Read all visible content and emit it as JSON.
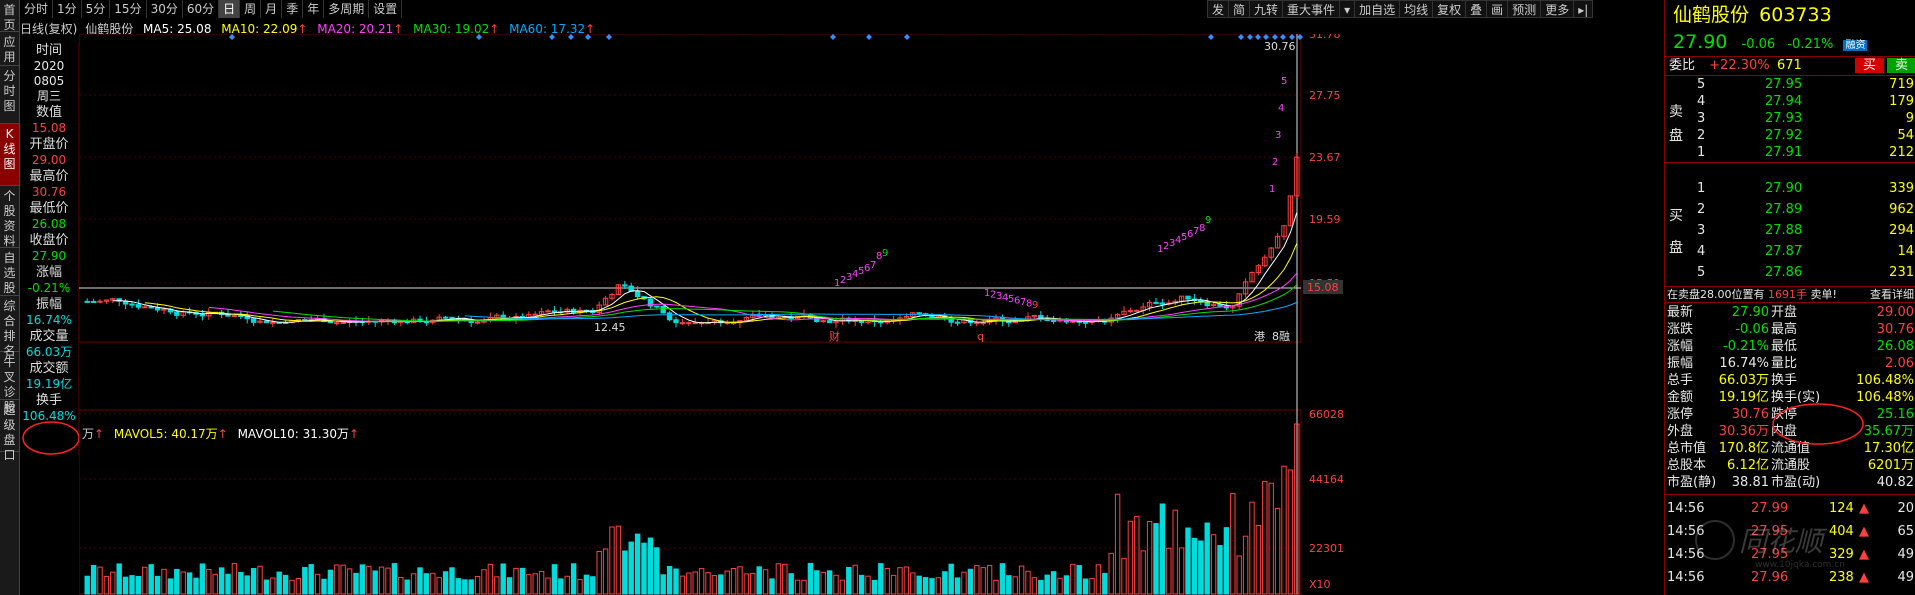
{
  "left_nav": [
    {
      "id": "home",
      "label": "首页"
    },
    {
      "id": "app",
      "label": "应用"
    },
    {
      "id": "intraday",
      "label": "分时图"
    },
    {
      "id": "kline",
      "label": "K线图",
      "active": true
    },
    {
      "id": "profile",
      "label": "个股资料"
    },
    {
      "id": "watchlist",
      "label": "自选股"
    },
    {
      "id": "rank",
      "label": "综合排名"
    },
    {
      "id": "niuwen",
      "label": "牛叉诊股"
    },
    {
      "id": "l2",
      "label": "超级盘口"
    }
  ],
  "period_tabs": [
    "分时",
    "1分",
    "5分",
    "15分",
    "30分",
    "60分",
    "日",
    "周",
    "月",
    "季",
    "年",
    "多周期",
    "设置"
  ],
  "period_active": "日",
  "toolbar_right": [
    "发",
    "简",
    "九转",
    "重大事件",
    "▾",
    "加自选",
    "均线",
    "复权",
    "叠",
    "画",
    "预测",
    "更多",
    "▸|"
  ],
  "chart_header": {
    "title": "日线(复权)",
    "stock": "仙鹤股份",
    "ma5": "MA5: 25.08",
    "ma10": "MA10: 22.09",
    "ma20": "MA20: 20.21",
    "ma30": "MA30: 19.02",
    "ma60": "MA60: 17.32",
    "arrow": "↑"
  },
  "info_column": [
    {
      "label": "时间",
      "value": null
    },
    {
      "label": null,
      "value": "2020",
      "color": "#e6e6e6"
    },
    {
      "label": null,
      "value": "0805",
      "color": "#e6e6e6"
    },
    {
      "label": null,
      "value": "周三",
      "color": "#e6e6e6"
    },
    {
      "label": "数值",
      "value": null
    },
    {
      "label": null,
      "value": "15.08",
      "color": "#ff4040"
    },
    {
      "label": "开盘价",
      "value": null
    },
    {
      "label": null,
      "value": "29.00",
      "color": "#ff4040"
    },
    {
      "label": "最高价",
      "value": null
    },
    {
      "label": null,
      "value": "30.76",
      "color": "#ff4040"
    },
    {
      "label": "最低价",
      "value": null
    },
    {
      "label": null,
      "value": "26.08",
      "color": "#00e000"
    },
    {
      "label": "收盘价",
      "value": null
    },
    {
      "label": null,
      "value": "27.90",
      "color": "#00e000"
    },
    {
      "label": "涨幅",
      "value": null
    },
    {
      "label": null,
      "value": "-0.21%",
      "color": "#00e000"
    },
    {
      "label": "振幅",
      "value": null
    },
    {
      "label": null,
      "value": "16.74%",
      "color": "#00dcdc"
    },
    {
      "label": "成交量",
      "value": null
    },
    {
      "label": null,
      "value": "66.03万",
      "color": "#00dcdc"
    },
    {
      "label": "成交额",
      "value": null
    },
    {
      "label": null,
      "value": "19.19亿",
      "color": "#00dcdc"
    },
    {
      "label": "换手",
      "value": null
    },
    {
      "label": null,
      "value": "106.48%",
      "color": "#00dcdc"
    }
  ],
  "price_axis": [
    "31.78",
    "27.75",
    "23.67",
    "19.59",
    "15.51"
  ],
  "price_axis_current": "15.08",
  "vol_axis": [
    "66028",
    "44164",
    "22301",
    "X10"
  ],
  "annotations": {
    "high_label": "30.76",
    "low_label": "12.45",
    "marker_cai": "财",
    "marker_q": "q",
    "marker_gang": "港",
    "marker_8": "8",
    "marker_ji": "融"
  },
  "td_seq_up_1": [
    "1",
    "2",
    "3",
    "4",
    "5",
    "6",
    "7",
    "8",
    "9"
  ],
  "td_seq_up_2": [
    "1",
    "2",
    "3",
    "4",
    "5",
    "6",
    "7",
    "8",
    "9"
  ],
  "td_seq_down": [
    "1",
    "2",
    "3",
    "4",
    "5",
    "6",
    "7",
    "8",
    "9"
  ],
  "td_seq_up_final": [
    "1",
    "2",
    "3",
    "4",
    "5"
  ],
  "vol_header": {
    "unit": "万",
    "arrow": "↑",
    "mavol5": "MAVOL5: 40.17万",
    "mavol10": "MAVOL10: 31.30万"
  },
  "quote": {
    "name": "仙鹤股份",
    "code": "603733",
    "price": "27.90",
    "change": "-0.06",
    "pct": "-0.21%",
    "tag": "融资",
    "webi_label": "委比",
    "webi_value": "+22.30%",
    "webi_diff": "671",
    "buy_btn": "买",
    "sell_btn": "卖"
  },
  "sell_levels": [
    {
      "n": "5",
      "price": "27.95",
      "vol": "719"
    },
    {
      "n": "4",
      "price": "27.94",
      "vol": "179"
    },
    {
      "n": "3",
      "price": "27.93",
      "vol": "9"
    },
    {
      "n": "2",
      "price": "27.92",
      "vol": "54"
    },
    {
      "n": "1",
      "price": "27.91",
      "vol": "212"
    }
  ],
  "buy_levels": [
    {
      "n": "1",
      "price": "27.90",
      "vol": "339"
    },
    {
      "n": "2",
      "price": "27.89",
      "vol": "962"
    },
    {
      "n": "3",
      "price": "27.88",
      "vol": "294"
    },
    {
      "n": "4",
      "price": "27.87",
      "vol": "14"
    },
    {
      "n": "5",
      "price": "27.86",
      "vol": "231"
    }
  ],
  "sell_side_label": [
    "卖",
    "盘"
  ],
  "buy_side_label": [
    "买",
    "盘"
  ],
  "order_notice": {
    "text": "在卖盘28.00位置有",
    "qty": "1691手",
    "tag": "卖单!",
    "link": "查看详细"
  },
  "stats": [
    {
      "l1": "最新",
      "v1": "27.90",
      "c1": "#00e000",
      "l2": "开盘",
      "v2": "29.00",
      "c2": "#ff4040"
    },
    {
      "l1": "涨跌",
      "v1": "-0.06",
      "c1": "#00e000",
      "l2": "最高",
      "v2": "30.76",
      "c2": "#ff4040"
    },
    {
      "l1": "涨幅",
      "v1": "-0.21%",
      "c1": "#00e000",
      "l2": "最低",
      "v2": "26.08",
      "c2": "#00e000"
    },
    {
      "l1": "振幅",
      "v1": "16.74%",
      "c1": "#e6e6e6",
      "l2": "量比",
      "v2": "2.06",
      "c2": "#ff4040"
    },
    {
      "l1": "总手",
      "v1": "66.03万",
      "c1": "#ffff00",
      "l2": "换手",
      "v2": "106.48%",
      "c2": "#ffff00"
    },
    {
      "l1": "金额",
      "v1": "19.19亿",
      "c1": "#ffff00",
      "l2": "换手(实)",
      "v2": "106.48%",
      "c2": "#ffff00"
    },
    {
      "l1": "涨停",
      "v1": "30.76",
      "c1": "#ff4040",
      "l2": "跌停",
      "v2": "25.16",
      "c2": "#00e000"
    },
    {
      "l1": "外盘",
      "v1": "30.36万",
      "c1": "#ff4040",
      "l2": "内盘",
      "v2": "35.67万",
      "c2": "#00e000"
    },
    {
      "l1": "总市值",
      "v1": "170.8亿",
      "c1": "#ffff00",
      "l2": "流通值",
      "v2": "17.30亿",
      "c2": "#ffff00"
    },
    {
      "l1": "总股本",
      "v1": "6.12亿",
      "c1": "#ffff00",
      "l2": "流通股",
      "v2": "6201万",
      "c2": "#ffff00"
    },
    {
      "l1": "市盈(静)",
      "v1": "38.81",
      "c1": "#e6e6e6",
      "l2": "市盈(动)",
      "v2": "40.82",
      "c2": "#e6e6e6"
    }
  ],
  "ticks": [
    {
      "time": "14:56",
      "price": "27.99",
      "pc": "#ff4040",
      "vol": "124",
      "dir": "up",
      "vol2": "20"
    },
    {
      "time": "14:56",
      "price": "27.95",
      "pc": "#ff4040",
      "vol": "404",
      "dir": "up",
      "vol2": "65"
    },
    {
      "time": "14:56",
      "price": "27.95",
      "pc": "#ff4040",
      "vol": "329",
      "dir": "up",
      "vol2": "49"
    },
    {
      "time": "14:56",
      "price": "27.96",
      "pc": "#ff4040",
      "vol": "238",
      "dir": "up",
      "vol2": "49"
    }
  ],
  "watermark": {
    "brand": "同花顺",
    "url": "www.10jqka.com.cn"
  },
  "colors": {
    "up": "#ff4040",
    "down": "#00dcdc",
    "ma5": "#ffffff",
    "ma10": "#ffff00",
    "ma20": "#ff40ff",
    "ma30": "#00e000",
    "ma60": "#00aaff",
    "grid": "#4a0000"
  }
}
